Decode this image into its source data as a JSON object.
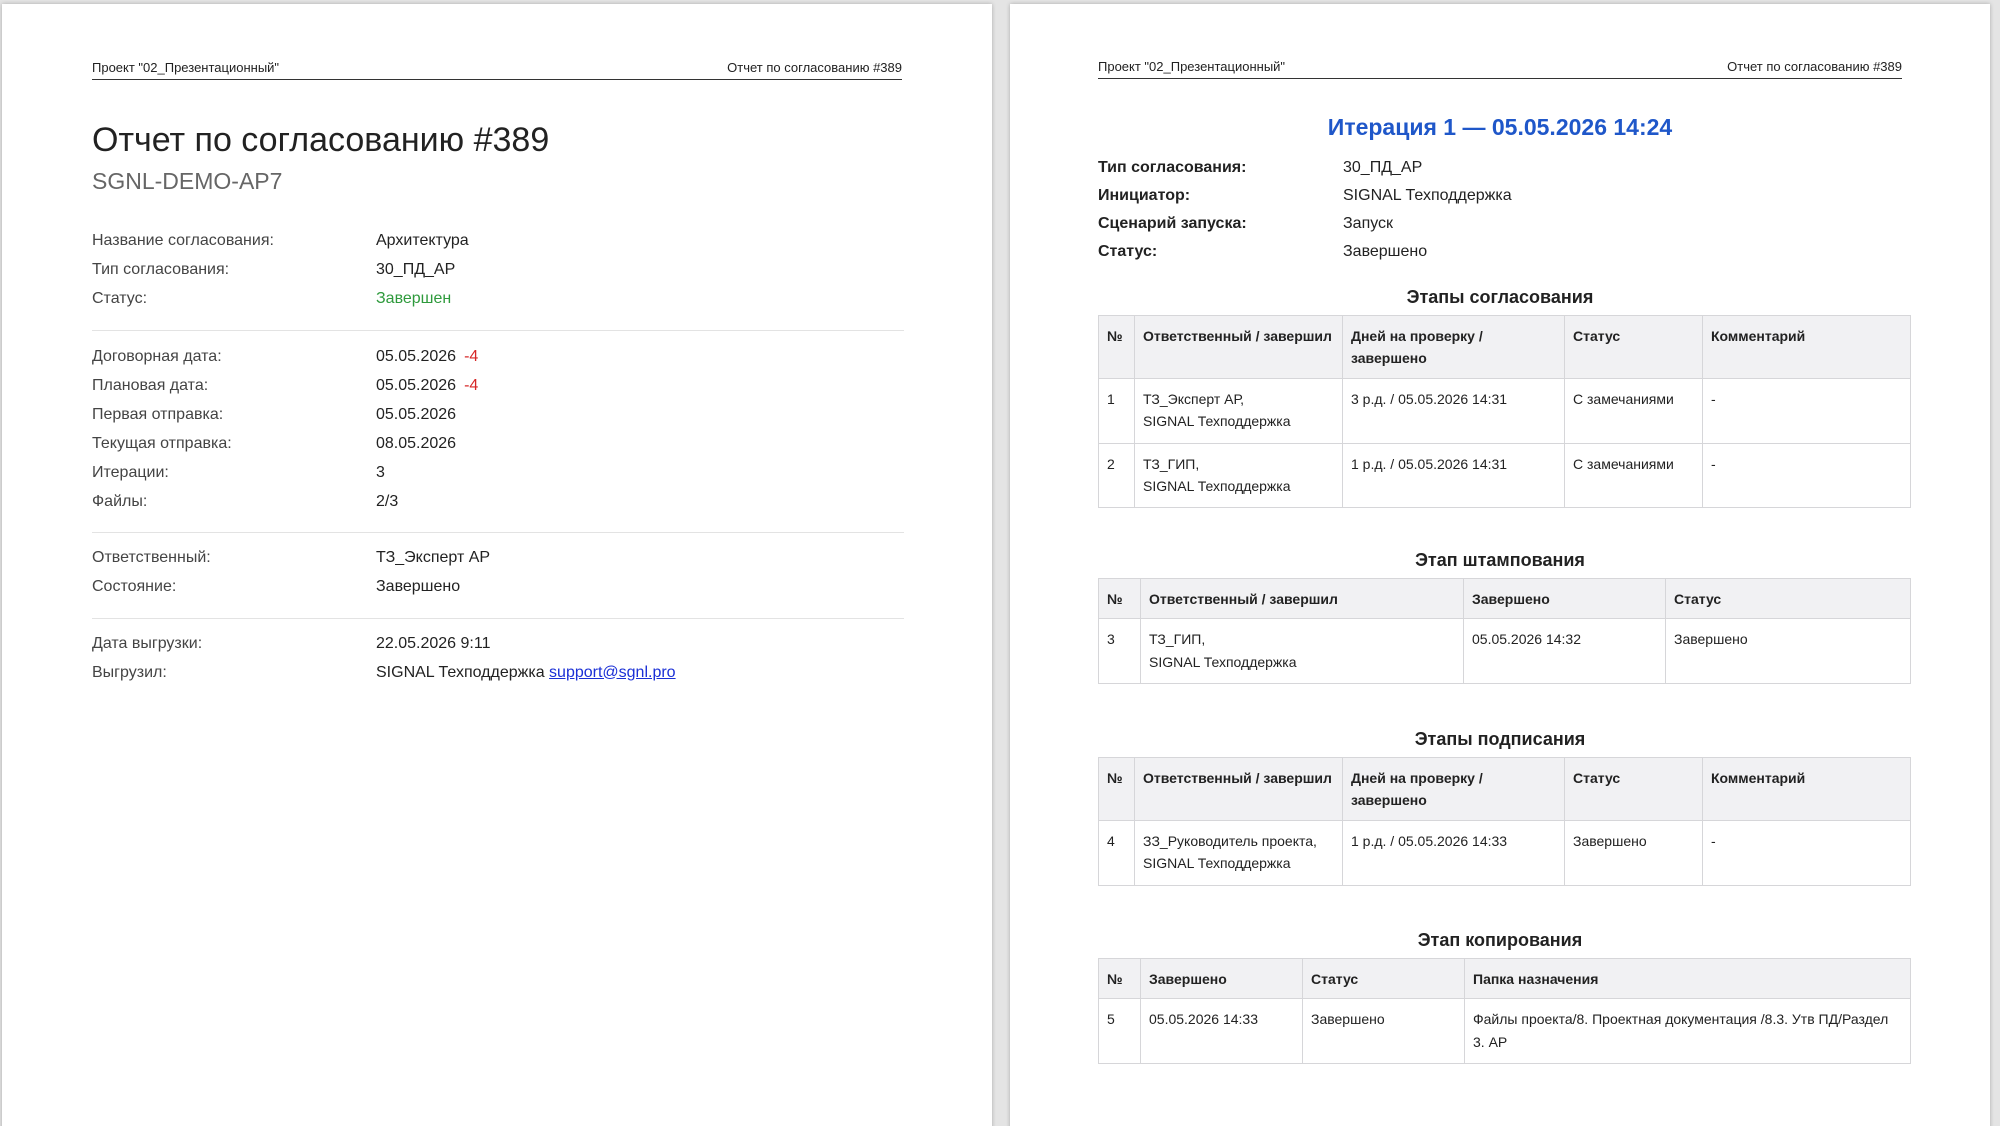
{
  "header": {
    "project": "Проект \"02_Презентационный\"",
    "report_ref": "Отчет по согласованию #389"
  },
  "report": {
    "title": "Отчет по согласованию #389",
    "code": "SGNL-DEMO-AP7",
    "group1": [
      {
        "label": "Название согласования:",
        "value": "Архитектура"
      },
      {
        "label": "Тип согласования:",
        "value": "30_ПД_АР"
      },
      {
        "label": "Статус:",
        "value": "Завершен"
      }
    ],
    "group2": [
      {
        "label": "Договорная дата:",
        "value": "05.05.2026",
        "delta": "-4"
      },
      {
        "label": "Плановая дата:",
        "value": "05.05.2026",
        "delta": "-4"
      },
      {
        "label": "Первая отправка:",
        "value": "05.05.2026"
      },
      {
        "label": "Текущая отправка:",
        "value": "08.05.2026"
      },
      {
        "label": "Итерации:",
        "value": "3"
      },
      {
        "label": "Файлы:",
        "value": "2/3"
      }
    ],
    "group3": [
      {
        "label": "Ответственный:",
        "value": "ТЗ_Эксперт АР"
      },
      {
        "label": "Состояние:",
        "value": "Завершено"
      }
    ],
    "group4": [
      {
        "label": "Дата выгрузки:",
        "value": "22.05.2026 9:11"
      },
      {
        "label": "Выгрузил:",
        "value": "SIGNAL Техподдержка",
        "email": "support@sgnl.pro"
      }
    ]
  },
  "iteration": {
    "title": "Итерация 1 —  05.05.2026 14:24",
    "rows": [
      {
        "label": "Тип согласования:",
        "value": "30_ПД_АР"
      },
      {
        "label": "Инициатор:",
        "value": "SIGNAL Техподдержка"
      },
      {
        "label": "Сценарий запуска:",
        "value": "Запуск"
      },
      {
        "label": "Статус:",
        "value": "Завершено"
      }
    ]
  },
  "approval_stages": {
    "title": "Этапы согласования",
    "headers": [
      "№",
      "Ответственный / завершил",
      "Дней на проверку / завершено",
      "Статус",
      "Комментарий"
    ],
    "rows": [
      {
        "n": "1",
        "resp": "ТЗ_Эксперт АР,",
        "resp2": "SIGNAL Техподдержка",
        "days": "3 р.д. / 05.05.2026 14:31",
        "status": "С замечаниями",
        "comment": "-"
      },
      {
        "n": "2",
        "resp": "ТЗ_ГИП,",
        "resp2": "SIGNAL Техподдержка",
        "days": "1 р.д. / 05.05.2026 14:31",
        "status": "С замечаниями",
        "comment": "-"
      }
    ]
  },
  "stamp_stage": {
    "title": "Этап штампования",
    "headers": [
      "№",
      "Ответственный / завершил",
      "Завершено",
      "Статус"
    ],
    "rows": [
      {
        "n": "3",
        "resp": "ТЗ_ГИП,",
        "resp2": "SIGNAL Техподдержка",
        "done": "05.05.2026 14:32",
        "status": "Завершено"
      }
    ]
  },
  "signing_stages": {
    "title": "Этапы подписания",
    "headers": [
      "№",
      "Ответственный / завершил",
      "Дней на проверку / завершено",
      "Статус",
      "Комментарий"
    ],
    "rows": [
      {
        "n": "4",
        "resp": "ЗЗ_Руководитель проекта,",
        "resp2": "SIGNAL Техподдержка",
        "days": "1 р.д. / 05.05.2026 14:33",
        "status": "Завершено",
        "comment": "-"
      }
    ]
  },
  "copy_stage": {
    "title": "Этап копирования",
    "headers": [
      "№",
      "Завершено",
      "Статус",
      "Папка назначения"
    ],
    "rows": [
      {
        "n": "5",
        "done": "05.05.2026 14:33",
        "status": "Завершено",
        "folder": "Файлы проекта/8. Проектная документация /8.3. Утв ПД/Раздел 3. АР"
      }
    ]
  },
  "colors": {
    "accent": "#1f57c9",
    "ok": "#2e9a3c",
    "warn": "#d9820a",
    "negative": "#d62626"
  }
}
